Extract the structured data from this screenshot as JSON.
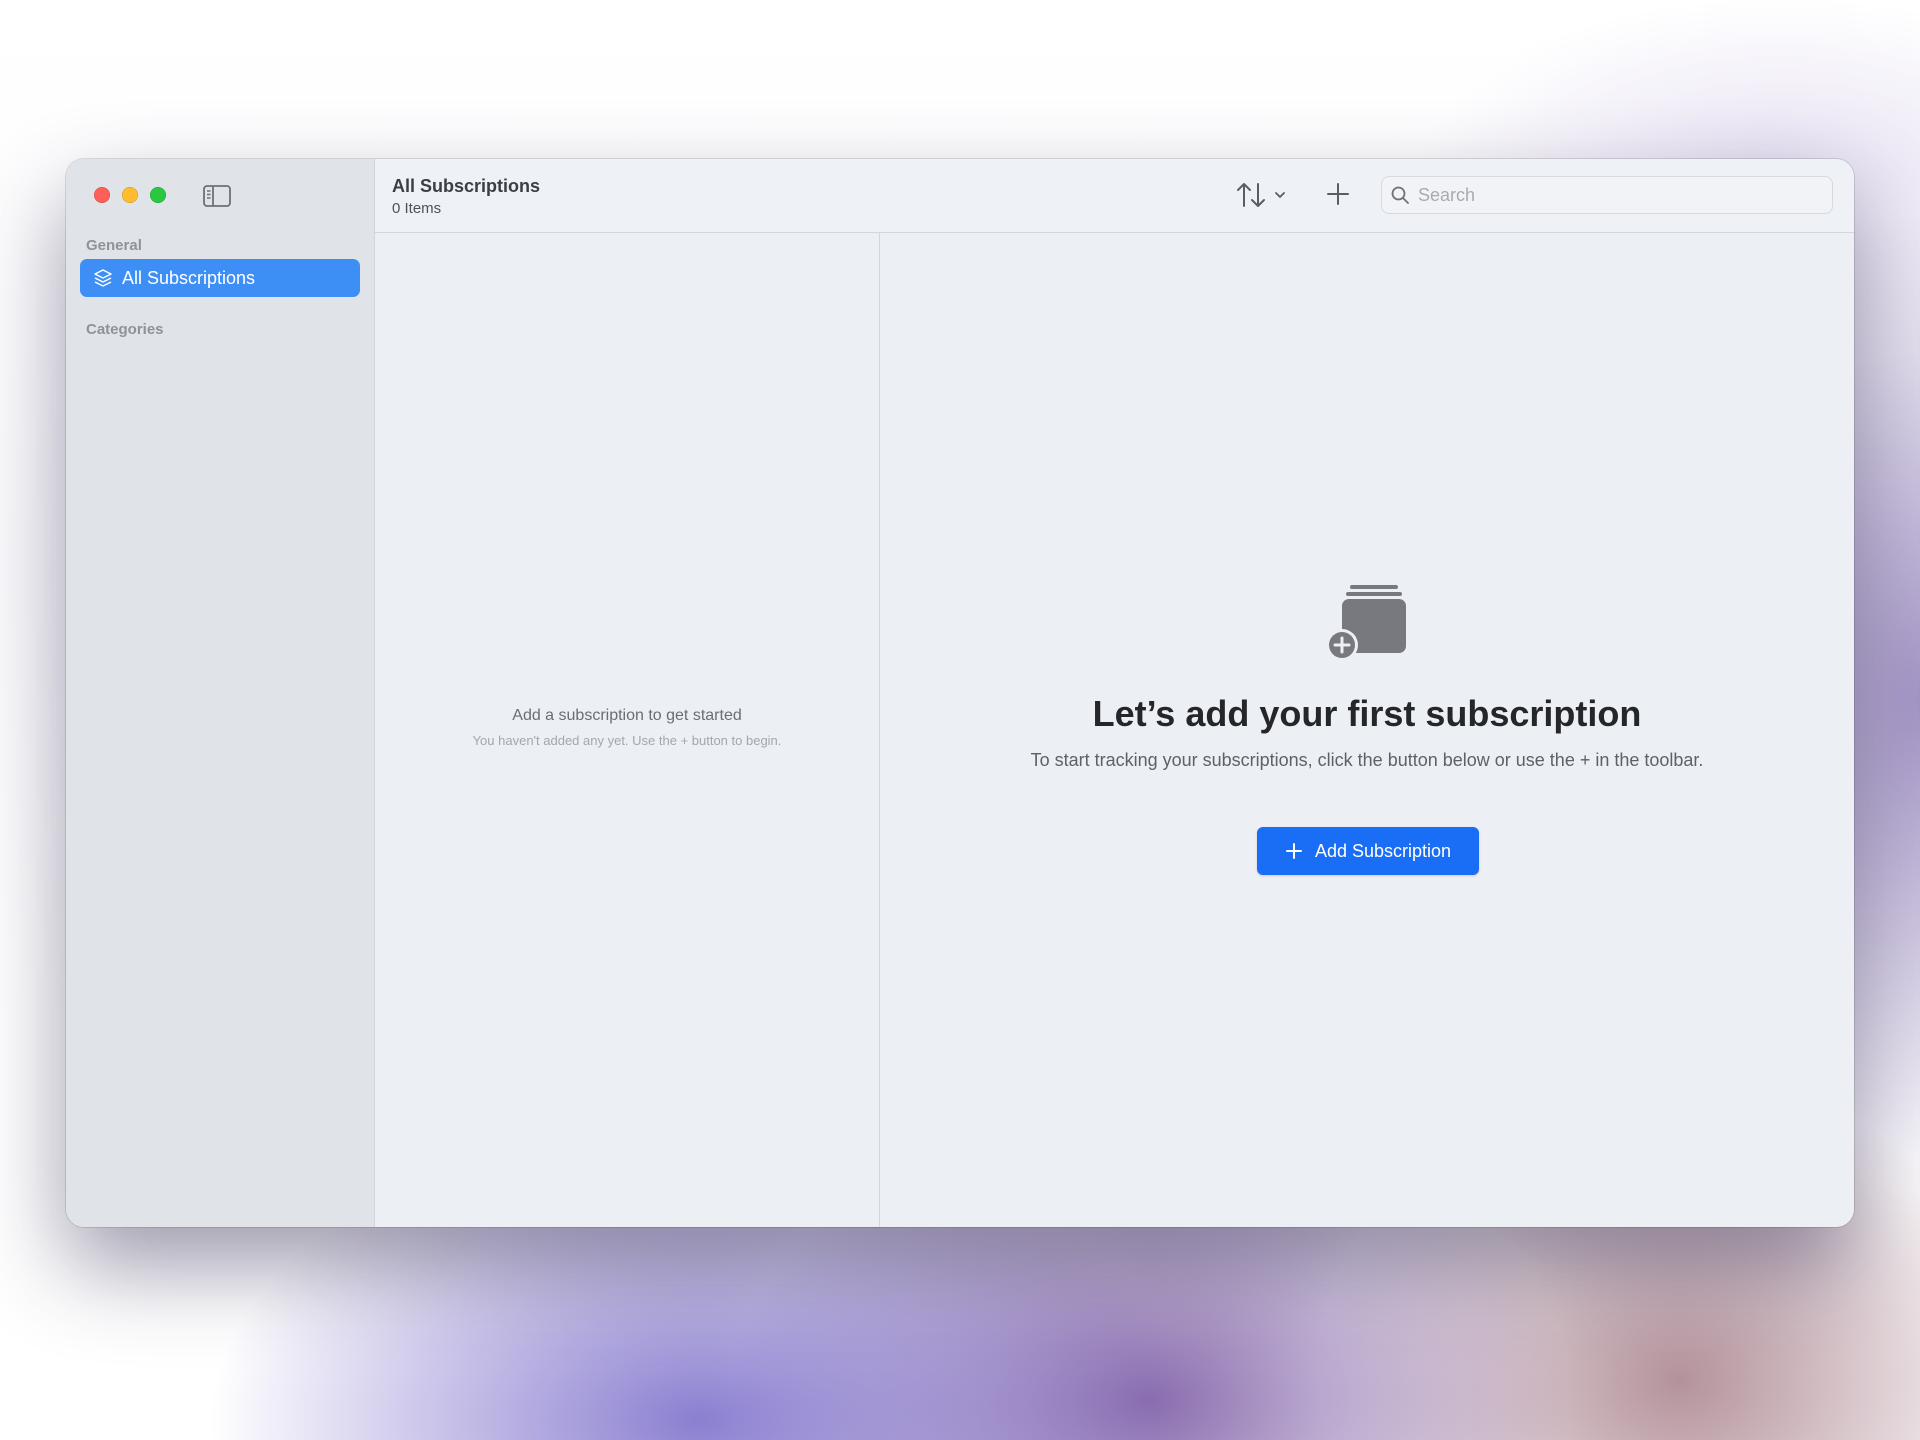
{
  "sidebar": {
    "general_label": "General",
    "categories_label": "Categories",
    "items": [
      {
        "label": "All Subscriptions",
        "icon": "stack-layers-icon",
        "selected": true
      }
    ]
  },
  "toolbar": {
    "title": "All Subscriptions",
    "subtitle": "0 Items",
    "search_placeholder": "Search"
  },
  "list": {
    "empty_title": "Add a subscription to get started",
    "empty_subtitle": "You haven't added any yet. Use the + button to begin."
  },
  "detail": {
    "title": "Let’s add your first subscription",
    "subtitle": "To start tracking your subscriptions, click the button below or use the + in the toolbar.",
    "button_label": "Add Subscription"
  },
  "colors": {
    "accent": "#1a6ef5",
    "sidebar_selection": "#3e8ff5",
    "close": "#ff5f57",
    "minimize": "#febc2e",
    "zoom": "#28c840"
  }
}
